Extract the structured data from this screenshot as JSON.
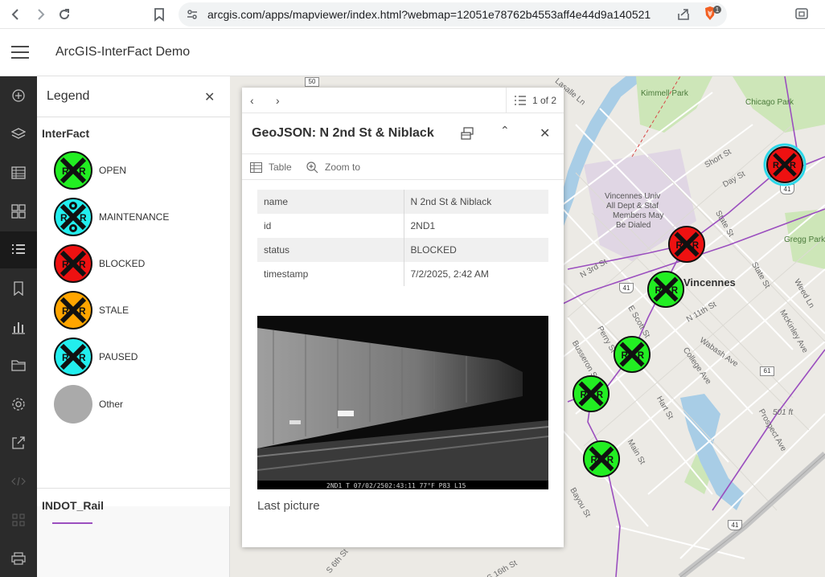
{
  "browser": {
    "url": "arcgis.com/apps/mapviewer/index.html?webmap=12051e78762b4553aff4e44d9a140521",
    "brave_badge": "1"
  },
  "header": {
    "title": "ArcGIS-InterFact Demo"
  },
  "toolbar": {
    "items": [
      "add-icon",
      "layers-icon",
      "table-icon",
      "basemap-icon",
      "legend-icon",
      "bookmark-icon",
      "charts-icon",
      "folder-icon",
      "settings-icon",
      "share-icon",
      "embed-icon",
      "apps-icon",
      "print-icon"
    ],
    "active": "legend-icon"
  },
  "legend": {
    "title": "Legend",
    "layer1": "InterFact",
    "items": [
      {
        "label": "OPEN",
        "color": "#22ee22"
      },
      {
        "label": "MAINTENANCE",
        "color": "#22eeee"
      },
      {
        "label": "BLOCKED",
        "color": "#ee1111"
      },
      {
        "label": "STALE",
        "color": "#ffa500"
      },
      {
        "label": "PAUSED",
        "color": "#22eeee"
      },
      {
        "label": "Other",
        "color": "#aaaaaa"
      }
    ],
    "layer2": "INDOT_Rail"
  },
  "map": {
    "labels": {
      "kimmell_park": "Kimmell Park",
      "chicago_park": "Chicago Park",
      "short_st": "Short St",
      "day_st": "Day St",
      "state_st": "State St",
      "gregg_park": "Gregg Park",
      "vincennes_univ": "Vincennes Univ",
      "univ2": "All Dept & Staf",
      "univ3": "Members May",
      "univ4": "Be Dialed",
      "vincennes": "Vincennes",
      "n3rd": "N 3rd St",
      "n11th": "N 11th St",
      "wabash": "Wabash Ave",
      "college": "College Ave",
      "state_st2": "State St",
      "weed_ln": "Weed Ln",
      "mckinley": "McKinley Ave",
      "prospect": "Prospect Ave",
      "elev": "501 ft",
      "hart_st": "Hart St",
      "main_st": "Main St",
      "bayou_st": "Bayou St",
      "busseron": "Busseron St",
      "perry": "Perry St",
      "e_scott": "E Scott St",
      "lasalle": "Lasalle Ln",
      "hwy50": "50",
      "hwy41a": "41",
      "hwy41b": "41",
      "hwy41c": "41",
      "hwy61": "61",
      "s16th": "S 16th St",
      "s6th": "S 6th St"
    }
  },
  "popup": {
    "page": "1 of 2",
    "title": "GeoJSON: N 2nd St & Niblack",
    "actions": {
      "table": "Table",
      "zoom": "Zoom to"
    },
    "attributes": [
      {
        "key": "name",
        "value": "N 2nd St & Niblack"
      },
      {
        "key": "id",
        "value": "2ND1"
      },
      {
        "key": "status",
        "value": "BLOCKED"
      },
      {
        "key": "timestamp",
        "value": "7/2/2025, 2:42 AM"
      }
    ],
    "camera_caption": "2ND1 T 07/02/2502:43:11 77°F P83 L15",
    "caption": "Last picture"
  }
}
